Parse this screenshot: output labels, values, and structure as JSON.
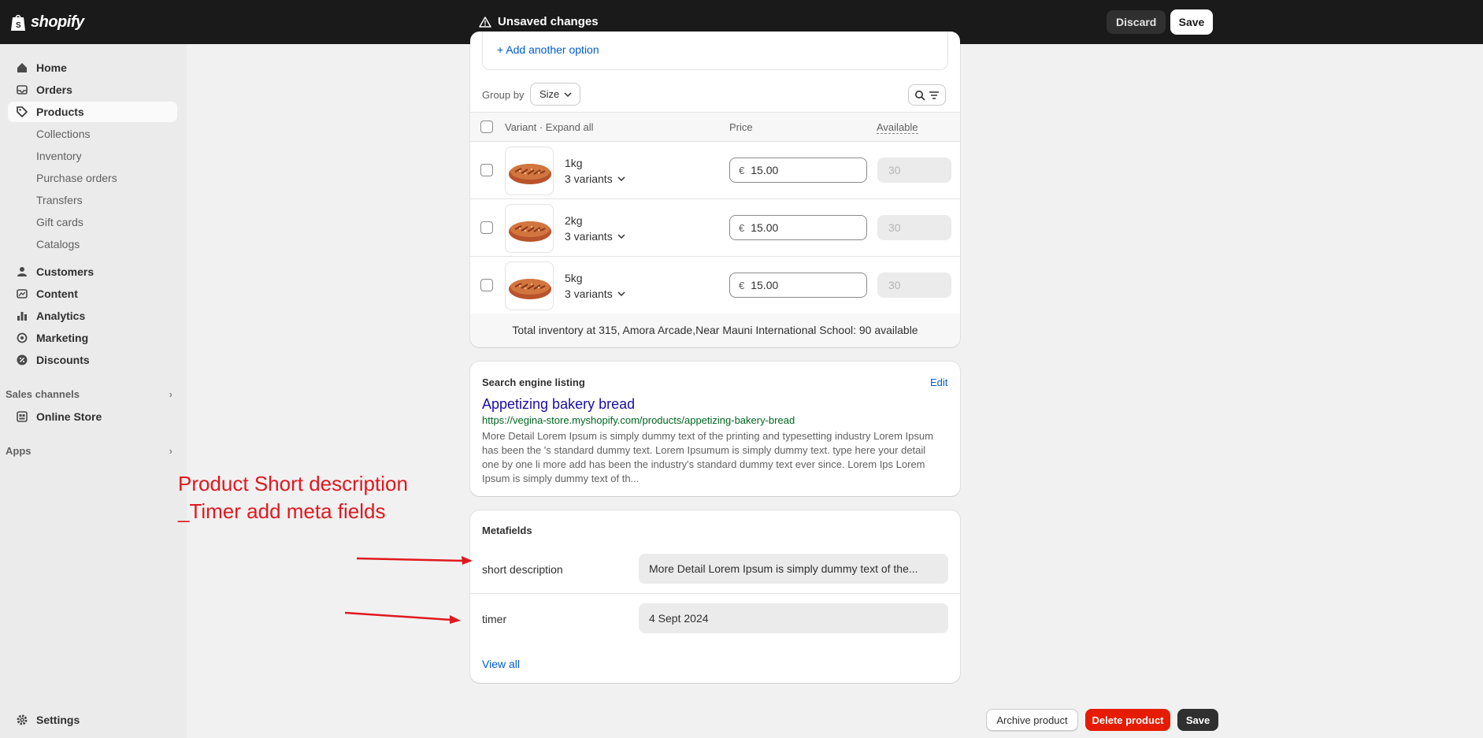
{
  "topbar": {
    "brand": "shopify",
    "status": "Unsaved changes",
    "discard_label": "Discard",
    "save_label": "Save"
  },
  "sidebar": {
    "items": [
      {
        "label": "Home",
        "icon": "home-icon"
      },
      {
        "label": "Orders",
        "icon": "inbox-icon"
      },
      {
        "label": "Products",
        "icon": "tag-icon",
        "active": true
      },
      {
        "label": "Customers",
        "icon": "person-icon"
      },
      {
        "label": "Content",
        "icon": "image-icon"
      },
      {
        "label": "Analytics",
        "icon": "bar-chart-icon"
      },
      {
        "label": "Marketing",
        "icon": "target-icon"
      },
      {
        "label": "Discounts",
        "icon": "discount-icon"
      }
    ],
    "product_sub": [
      "Collections",
      "Inventory",
      "Purchase orders",
      "Transfers",
      "Gift cards",
      "Catalogs"
    ],
    "sales_channels_label": "Sales channels",
    "online_store_label": "Online Store",
    "apps_label": "Apps",
    "settings_label": "Settings"
  },
  "variants": {
    "add_option": "Add another option",
    "group_by_label": "Group by",
    "group_by_value": "Size",
    "col_variant": "Variant · Expand all",
    "col_price": "Price",
    "col_available": "Available",
    "rows": [
      {
        "name": "1kg",
        "count": "3 variants",
        "currency": "€",
        "price": "15.00",
        "available": "30"
      },
      {
        "name": "2kg",
        "count": "3 variants",
        "currency": "€",
        "price": "15.00",
        "available": "30"
      },
      {
        "name": "5kg",
        "count": "3 variants",
        "currency": "€",
        "price": "15.00",
        "available": "30"
      }
    ],
    "total": "Total inventory at 315, Amora Arcade,Near Mauni International School: 90 available"
  },
  "seo": {
    "title": "Search engine listing",
    "edit_label": "Edit",
    "page_title": "Appetizing bakery bread",
    "url": "https://vegina-store.myshopify.com/products/appetizing-bakery-bread",
    "description": "More Detail Lorem Ipsum is simply dummy text of the printing and typesetting industry Lorem Ipsum has been the 's standard dummy text. Lorem Ipsumum is simply dummy text. type here your detail one by one li more add has been the industry's standard dummy text ever since. Lorem Ips Lorem Ipsum is simply dummy text of th..."
  },
  "metafields": {
    "title": "Metafields",
    "short_description_label": "short description",
    "short_description_value": "More Detail Lorem Ipsum is simply dummy text of the...",
    "timer_label": "timer",
    "timer_value": "4 Sept 2024",
    "view_all_label": "View all"
  },
  "actions": {
    "archive_label": "Archive product",
    "delete_label": "Delete product",
    "save_label": "Save"
  },
  "annotation": {
    "line1": "Product Short description",
    "line2": "_Timer add meta fields"
  },
  "colors": {
    "topbar": "#1a1a1a",
    "link": "#005bd3",
    "delete": "#e51c00",
    "annotation": "#e0191f"
  }
}
